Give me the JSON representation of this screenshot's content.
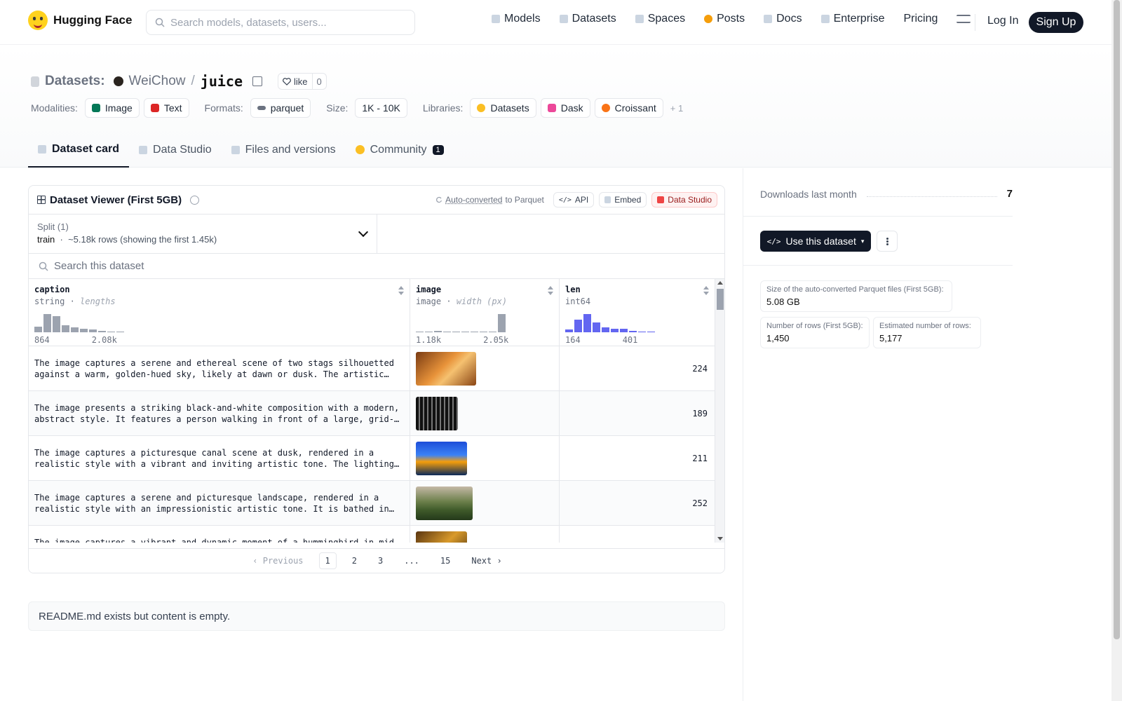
{
  "header": {
    "brand": "Hugging Face",
    "search_placeholder": "Search models, datasets, users...",
    "nav": [
      "Models",
      "Datasets",
      "Spaces",
      "Posts",
      "Docs",
      "Enterprise",
      "Pricing"
    ],
    "login": "Log In",
    "signup": "Sign Up"
  },
  "repo": {
    "kind": "Datasets:",
    "owner": "WeiChow",
    "sep": "/",
    "name": "juice",
    "like_label": "like",
    "like_count": "0"
  },
  "tags": {
    "modalities_label": "Modalities:",
    "modalities": [
      "Image",
      "Text"
    ],
    "formats_label": "Formats:",
    "formats": [
      "parquet"
    ],
    "size_label": "Size:",
    "size": "1K - 10K",
    "libraries_label": "Libraries:",
    "libraries": [
      "Datasets",
      "Dask",
      "Croissant"
    ],
    "more": "+ 1"
  },
  "tabs": {
    "card": "Dataset card",
    "studio": "Data Studio",
    "files": "Files and versions",
    "community": "Community",
    "community_count": "1"
  },
  "viewer": {
    "title": "Dataset Viewer (First 5GB)",
    "auto_converted": "Auto-converted",
    "to_parquet": "to Parquet",
    "api": "API",
    "embed": "Embed",
    "data_studio": "Data Studio",
    "split_label": "Split (1)",
    "split_name": "train",
    "split_info": "~5.18k rows (showing the first 1.45k)",
    "search_placeholder": "Search this dataset",
    "columns": [
      {
        "name": "caption",
        "type": "string",
        "stat": "lengths",
        "min": "864",
        "max": "2.08k",
        "hist": [
          0.3,
          1.0,
          0.9,
          0.4,
          0.25,
          0.2,
          0.15,
          0.08,
          0.05,
          0.05
        ]
      },
      {
        "name": "image",
        "type": "image",
        "stat": "width (px)",
        "min": "1.18k",
        "max": "2.05k",
        "hist": [
          0.05,
          0.05,
          0.08,
          0.05,
          0.05,
          0.05,
          0.05,
          0.05,
          0.05,
          1.0
        ]
      },
      {
        "name": "len",
        "type": "int64",
        "stat": "",
        "min": "164",
        "max": "401",
        "hist": [
          0.15,
          0.7,
          1.0,
          0.55,
          0.25,
          0.2,
          0.2,
          0.08,
          0.05,
          0.05
        ]
      }
    ],
    "rows": [
      {
        "caption": "The image captures a serene and ethereal scene of two stags silhouetted against a warm, golden-hued sky, likely at dawn or dusk. The artistic tone is calm and dreamlike.",
        "len": "224"
      },
      {
        "caption": "The image presents a striking black-and-white composition with a modern, abstract style. It features a person walking in front of a large, grid-like structure.",
        "len": "189"
      },
      {
        "caption": "The image captures a picturesque canal scene at dusk, rendered in a realistic style with a vibrant and inviting artistic tone. The lighting is warm and glowing.",
        "len": "211"
      },
      {
        "caption": "The image captures a serene and picturesque landscape, rendered in a realistic style with an impressionistic artistic tone. It is bathed in soft light.",
        "len": "252"
      },
      {
        "caption": "The image captures a vibrant and dynamic moment of a hummingbird in mid-flight.",
        "len": ""
      }
    ],
    "pager": {
      "prev": "Previous",
      "pages": [
        "1",
        "2",
        "3",
        "...",
        "15"
      ],
      "next": "Next"
    }
  },
  "readme": "README.md exists but content is empty.",
  "sidebar": {
    "downloads_label": "Downloads last month",
    "downloads": "7",
    "use_button": "Use this dataset",
    "parquet_size_label": "Size of the auto-converted Parquet files (First 5GB):",
    "parquet_size": "5.08 GB",
    "rows_label": "Number of rows (First 5GB):",
    "rows": "1,450",
    "est_rows_label": "Estimated number of rows:",
    "est_rows": "5,177"
  }
}
